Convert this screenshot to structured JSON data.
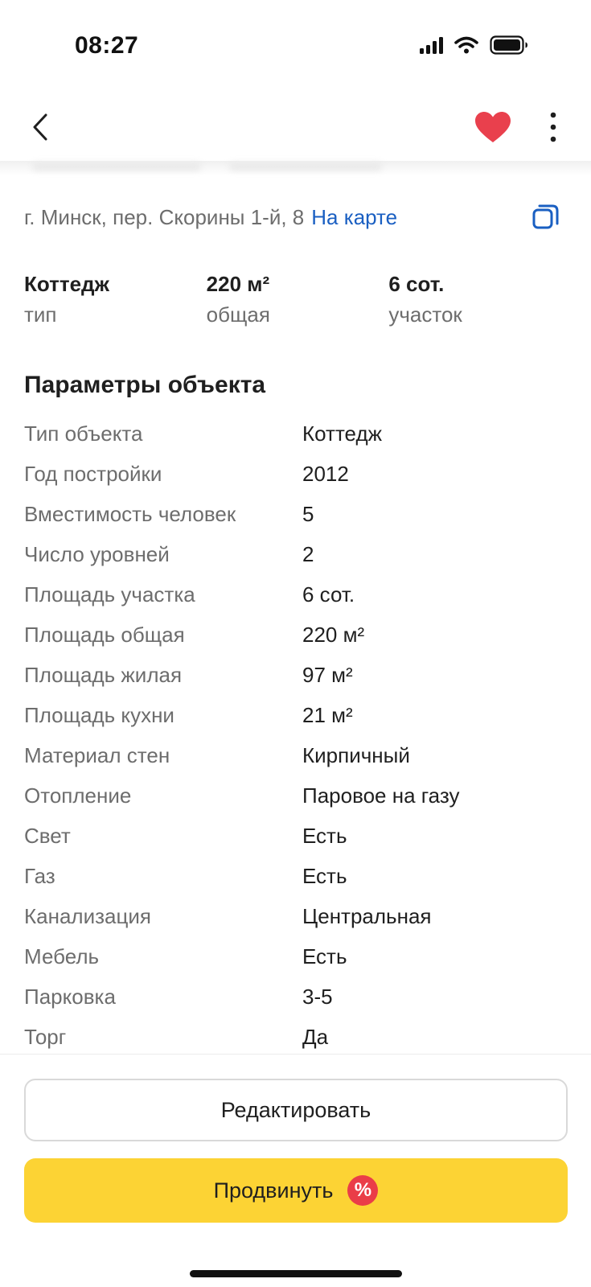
{
  "status_bar": {
    "time": "08:27"
  },
  "header": {
    "back_icon": "chevron-left-icon",
    "favorite_icon": "heart-icon",
    "favorite_color": "#e9404d",
    "more_icon": "more-vertical-icon"
  },
  "address": {
    "text": "г. Минск, пер. Скорины 1-й, 8",
    "map_link": "На карте",
    "copy_icon": "copy-icon",
    "link_color": "#1a5fc2"
  },
  "summary": [
    {
      "value": "Коттедж",
      "label": "тип"
    },
    {
      "value": "220 м²",
      "label": "общая"
    },
    {
      "value": "6 сот.",
      "label": "участок"
    }
  ],
  "params": {
    "title": "Параметры объекта",
    "rows": [
      {
        "key": "Тип объекта",
        "value": "Коттедж"
      },
      {
        "key": "Год постройки",
        "value": "2012"
      },
      {
        "key": "Вместимость человек",
        "value": "5"
      },
      {
        "key": "Число уровней",
        "value": "2"
      },
      {
        "key": "Площадь участка",
        "value": "6 сот."
      },
      {
        "key": "Площадь общая",
        "value": "220 м²"
      },
      {
        "key": "Площадь жилая",
        "value": "97 м²"
      },
      {
        "key": "Площадь кухни",
        "value": "21 м²"
      },
      {
        "key": "Материал стен",
        "value": "Кирпичный"
      },
      {
        "key": "Отопление",
        "value": "Паровое на газу"
      },
      {
        "key": "Свет",
        "value": "Есть"
      },
      {
        "key": "Газ",
        "value": "Есть"
      },
      {
        "key": "Канализация",
        "value": "Центральная"
      },
      {
        "key": "Мебель",
        "value": "Есть"
      },
      {
        "key": "Парковка",
        "value": "3-5"
      },
      {
        "key": "Торг",
        "value": "Да"
      }
    ]
  },
  "actions": {
    "edit_label": "Редактировать",
    "promote_label": "Продвинуть",
    "promote_badge": "%",
    "promote_color": "#fcd334",
    "badge_color": "#ea3d48"
  }
}
